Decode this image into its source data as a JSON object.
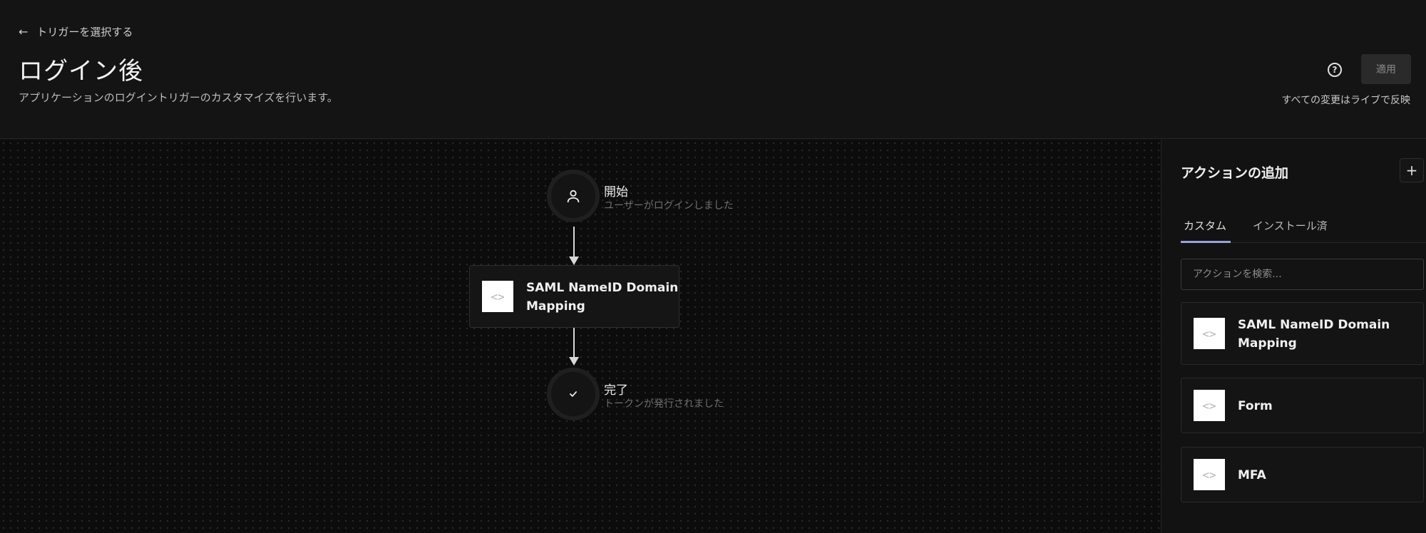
{
  "header": {
    "back_label": "トリガーを選択する",
    "title": "ログイン後",
    "subtitle": "アプリケーションのログイントリガーのカスタマイズを行います。",
    "help_icon": "?",
    "apply_label": "適用",
    "live_note": "すべての変更はライブで反映"
  },
  "flow": {
    "start": {
      "label": "開始",
      "sub": "ユーザーがログインしました",
      "icon": "user-icon"
    },
    "action": {
      "title_line1": "SAML NameID Domain",
      "title_line2": "Mapping",
      "icon": "code-icon"
    },
    "end": {
      "label": "完了",
      "sub": "トークンが発行されました",
      "icon": "check-icon"
    }
  },
  "panel": {
    "title": "アクションの追加",
    "add_label": "+",
    "tabs": [
      {
        "label": "カスタム",
        "active": true
      },
      {
        "label": "インストール済",
        "active": false
      }
    ],
    "search_placeholder": "アクションを検索...",
    "actions": [
      {
        "line1": "SAML NameID Domain",
        "line2": "Mapping"
      },
      {
        "line1": "Form",
        "line2": ""
      },
      {
        "line1": "MFA",
        "line2": ""
      }
    ]
  },
  "colors": {
    "background": "#111111",
    "canvas": "#0c0c0c",
    "tab_accent": "#9aa3d8"
  }
}
